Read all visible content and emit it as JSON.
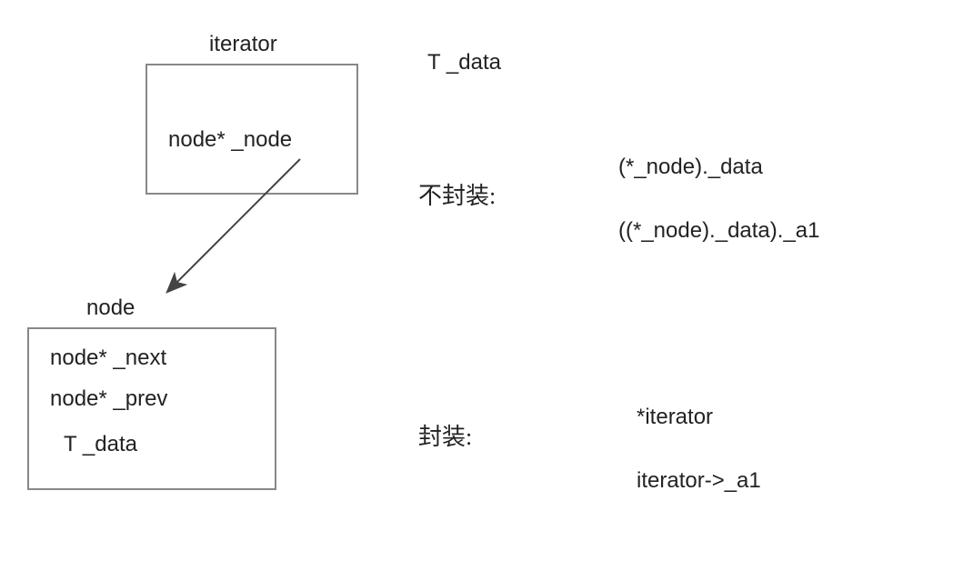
{
  "iterator_box": {
    "title": "iterator",
    "field": "node*  _node"
  },
  "node_box": {
    "title": "node",
    "field_next": "node* _next",
    "field_prev": "node* _prev",
    "field_data": "T _data"
  },
  "right": {
    "t_data": "T _data",
    "no_wrap_label": "不封装:",
    "no_wrap_expr1": "(*_node)._data",
    "no_wrap_expr2": "((*_node)._data)._a1",
    "wrap_label": "封装:",
    "wrap_expr1": "*iterator",
    "wrap_expr2": "iterator->_a1"
  }
}
